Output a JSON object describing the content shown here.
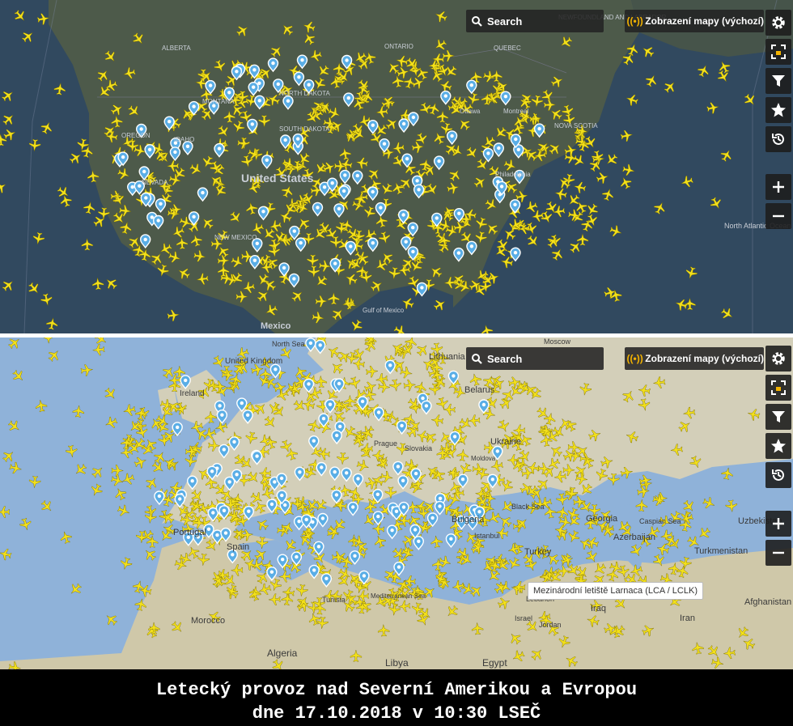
{
  "colors": {
    "plane": "#f3e01a",
    "pin": "#4aa3df",
    "ocean_na": "#31495f",
    "land_na": "#4d5a4a",
    "ocean_eu": "#8fb2d9",
    "land_eu": "#cfcab3",
    "accent": "#f3b300"
  },
  "toolbar": {
    "search_label": "Search",
    "view_label": "Zobrazení mapy (výchozí)",
    "icons": [
      "gear-icon",
      "fullscreen-lock-icon",
      "filter-icon",
      "star-icon",
      "history-icon",
      "zoom-in-icon",
      "zoom-out-icon"
    ]
  },
  "north_america": {
    "labels": {
      "ontario": "ONTARIO",
      "quebec": "QUEBEC",
      "labrador": "NEWFOUNDLAND AND LABRADOR",
      "alberta": "ALBERTA",
      "montana": "MONTANA",
      "north_dakota": "NORTH DAKOTA",
      "south_dakota": "SOUTH DAKOTA",
      "idaho": "IDAHO",
      "oregon": "OREGON",
      "nevada": "NEVADA",
      "usa": "United States",
      "new_mexico": "NEW MEXICO",
      "ottawa": "Ottawa",
      "montreal": "Montreal",
      "nova_scotia": "NOVA SCOTIA",
      "philadelphia": "Philadelphia",
      "north_atlantic": "North Atlantic Ocean",
      "gulf": "Gulf of Mexico",
      "mexico": "Mexico"
    }
  },
  "europe": {
    "labels": {
      "north_sea": "North Sea",
      "lithuania": "Lithuania",
      "moscow": "Moscow",
      "united_kingdom": "United Kingdom",
      "ireland": "Ireland",
      "belarus": "Belarus",
      "prague": "Prague",
      "slovakia": "Slovakia",
      "ukraine": "Ukraine",
      "moldova": "Moldova",
      "black_sea": "Black Sea",
      "georgia": "Georgia",
      "caspian_sea": "Caspian Sea",
      "uzbekistan": "Uzbekistan",
      "azerbaijan": "Azerbaijan",
      "turkmenistan": "Turkmenistan",
      "portugal": "Portugal",
      "spain": "Spain",
      "bulgaria": "Bulgaria",
      "istanbul": "Istanbul",
      "turkey": "Turkey",
      "tunisia": "Tunisia",
      "mediterranean": "Mediterranean Sea",
      "lebanon": "Lebanon",
      "israel": "Israel",
      "jordan": "Jordan",
      "iraq": "Iraq",
      "iran": "Iran",
      "afghanistan": "Afghanistan",
      "morocco": "Morocco",
      "algeria": "Algeria",
      "libya": "Libya",
      "egypt": "Egypt"
    },
    "tooltip": "Mezinárodní letiště Larnaca (LCA / LCLK)"
  },
  "caption": {
    "line1": "Letecký provoz nad Severní Amerikou a Evropou",
    "line2": "dne 17.10.2018 v 10:30 LSEČ"
  }
}
